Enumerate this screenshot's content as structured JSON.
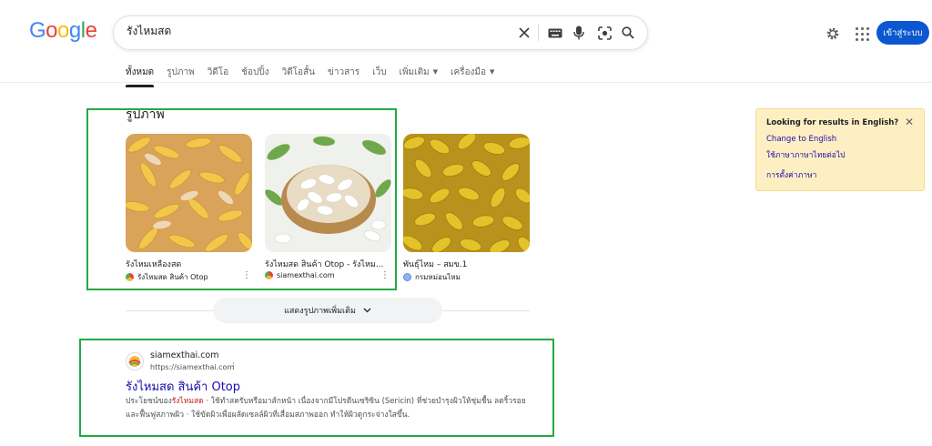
{
  "logo": {
    "letters": [
      "G",
      "o",
      "o",
      "g",
      "l",
      "e"
    ],
    "colors": [
      "#4285f4",
      "#ea4335",
      "#fbbc05",
      "#4285f4",
      "#34a853",
      "#ea4335"
    ]
  },
  "search": {
    "query": "รังไหมสด"
  },
  "header": {
    "signin_label": "เข้าสู่ระบบ"
  },
  "tabs": [
    {
      "label": "ทั้งหมด",
      "active": true
    },
    {
      "label": "รูปภาพ"
    },
    {
      "label": "วิดีโอ"
    },
    {
      "label": "ช้อปปิ้ง"
    },
    {
      "label": "วิดีโอสั้น"
    },
    {
      "label": "ข่าวสาร"
    },
    {
      "label": "เว็บ"
    },
    {
      "label": "เพิ่มเติม",
      "caret": true
    },
    {
      "label": "เครื่องมือ",
      "caret": true
    }
  ],
  "images_section": {
    "title": "รูปภาพ",
    "items": [
      {
        "caption": "รังไหมเหลืองสด",
        "source": "รังไหมสด สินค้า Otop"
      },
      {
        "caption": "รังไหมสด สินค้า Otop - รังไหม...",
        "source": "siamexthai.com"
      },
      {
        "caption": "พันธุ์ไหม – สมข.1",
        "source": "กรมหม่อนไหม"
      }
    ],
    "more_label": "แสดงรูปภาพเพิ่มเติม"
  },
  "result": {
    "site_name": "siamexthai.com",
    "url": "https://siamexthai.com",
    "title": "รังไหมสด สินค้า Otop",
    "snippet_prefix": "ประโยชน์ของ",
    "snippet_highlight": "รังไหมสด",
    "snippet_rest": " · ใช้ทำสครับหรือมาส์กหน้า เนื่องจากมีโปรตีนเซริซิน (Sericin) ที่ช่วยบำรุงผิวให้ชุ่มชื้น ลดริ้วรอย และฟื้นฟูสภาพผิว · ใช้ขัดผิวเพื่อผลัดเซลล์ผิวที่เสื่อมสภาพออก ทำให้ผิวดูกระจ่างใสขึ้น."
  },
  "language_box": {
    "title": "Looking for results in English?",
    "change_link": "Change to English",
    "keep_link": "ใช้ภาษาภาษาไทยต่อไป",
    "settings_link": "การตั้งค่าภาษา"
  },
  "icons": [
    "clear-icon",
    "keyboard-icon",
    "mic-icon",
    "lens-icon",
    "search-icon",
    "gear-icon",
    "apps-icon",
    "chevron-down-icon",
    "more-vert-icon",
    "close-icon"
  ]
}
